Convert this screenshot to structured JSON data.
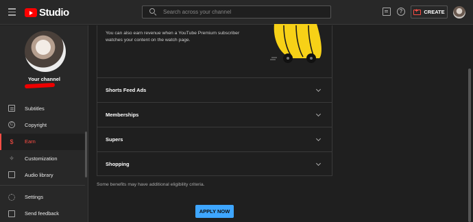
{
  "app": {
    "logo_text": "Studio",
    "search_placeholder": "Search across your channel",
    "create_label": "CREATE"
  },
  "sidebar": {
    "channel_label": "Your channel",
    "items": [
      {
        "label": "Subtitles",
        "icon": "subtitles-icon"
      },
      {
        "label": "Copyright",
        "icon": "copyright-icon",
        "glyph": "C"
      },
      {
        "label": "Earn",
        "icon": "dollar-icon",
        "glyph": "$",
        "active": true
      },
      {
        "label": "Customization",
        "icon": "magic-wand-icon",
        "glyph": "✧"
      },
      {
        "label": "Audio library",
        "icon": "audio-library-icon"
      }
    ],
    "bottom_items": [
      {
        "label": "Settings",
        "icon": "gear-icon"
      },
      {
        "label": "Send feedback",
        "icon": "feedback-icon"
      }
    ]
  },
  "main": {
    "premium_text": "You can also earn revenue when a YouTube Premium subscriber watches your content on the watch page.",
    "sections": [
      {
        "title": "Shorts Feed Ads"
      },
      {
        "title": "Memberships"
      },
      {
        "title": "Supers"
      },
      {
        "title": "Shopping"
      }
    ],
    "note": "Some benefits may have additional eligibility criteria.",
    "apply_label": "APPLY NOW"
  },
  "colors": {
    "accent": "#ff4e45",
    "brand_red": "#ff0000",
    "button_blue": "#3ea6ff",
    "banana_yellow": "#f7d117"
  }
}
